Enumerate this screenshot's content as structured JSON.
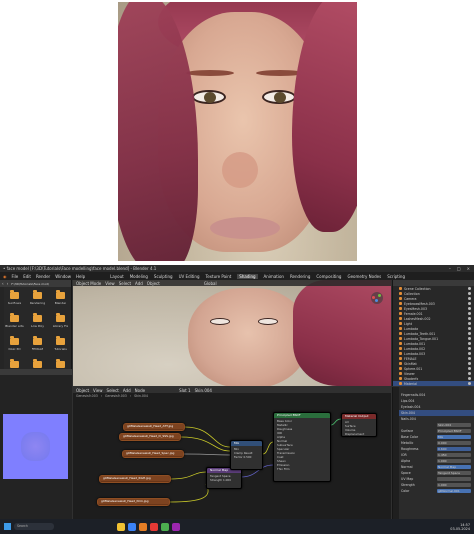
{
  "window": {
    "title": "• face model [F:\\3D\\Tutorials\\Face modelling\\face model.blend] - Blender 4.1"
  },
  "menu": {
    "items": [
      "File",
      "Edit",
      "Render",
      "Window",
      "Help"
    ],
    "workspaces": [
      "Layout",
      "Modeling",
      "Sculpting",
      "UV Editing",
      "Texture Paint",
      "Shading",
      "Animation",
      "Rendering",
      "Compositing",
      "Geometry Nodes",
      "Scripting"
    ],
    "active_workspace": "Shading"
  },
  "file_browser": {
    "path": "F:\\3D\\Tutorials\\Face mod\\",
    "folders": [
      "Sunflowe",
      "Rendering",
      "Blender",
      "Blender arts",
      "Low Poly",
      "Library Fix",
      "DALI 3D",
      "FEMALE",
      "Tutorials",
      "Bluestar",
      "Texture",
      "Ovally",
      "Obsidian",
      "Substance",
      "Fiddle"
    ]
  },
  "viewport": {
    "mode": "Object Mode",
    "shading": "Global"
  },
  "outliner": {
    "rows": [
      {
        "label": "Scene Collection",
        "selected": false
      },
      {
        "label": "Collection",
        "selected": false
      },
      {
        "label": "Camera",
        "selected": false
      },
      {
        "label": "EyebrowsMesh.003",
        "selected": false
      },
      {
        "label": "EyesMesh.003",
        "selected": false
      },
      {
        "label": "Female.001",
        "selected": false
      },
      {
        "label": "LashesMesh.002",
        "selected": false
      },
      {
        "label": "Light",
        "selected": false
      },
      {
        "label": "Lumbata",
        "selected": false
      },
      {
        "label": "Lumbata_Teeth.001",
        "selected": false
      },
      {
        "label": "Lumbata_Tongue.001",
        "selected": false
      },
      {
        "label": "Lumbata.001",
        "selected": false
      },
      {
        "label": "Lumbata.002",
        "selected": false
      },
      {
        "label": "Lumbata.003",
        "selected": false
      },
      {
        "label": "FEMALE",
        "selected": false
      },
      {
        "label": "SkinMat",
        "selected": false
      },
      {
        "label": "Sphere.001",
        "selected": false
      },
      {
        "label": "Viewer",
        "selected": false
      },
      {
        "label": "Shaderfx",
        "selected": false
      },
      {
        "label": "Material",
        "selected": true
      }
    ]
  },
  "properties": {
    "material_list": [
      "Fingernails.004",
      "Lips.004",
      "Eyelash.004",
      "Skin.004",
      "Nails.004"
    ],
    "active_material": "Skin.004",
    "rows": [
      {
        "label": "Surface",
        "value": "Principled BSDF",
        "style": ""
      },
      {
        "label": "Base Color",
        "value": "Mix",
        "style": "blue"
      },
      {
        "label": "Metallic",
        "value": "0.000",
        "style": ""
      },
      {
        "label": "Roughness",
        "value": "0.600",
        "style": "sel"
      },
      {
        "label": "IOR",
        "value": "1.450",
        "style": ""
      },
      {
        "label": "Alpha",
        "value": "1.000",
        "style": ""
      },
      {
        "label": "Normal",
        "value": "Normal Map",
        "style": "blue"
      },
      {
        "label": "Space",
        "value": "Tangent Space",
        "style": ""
      },
      {
        "label": "UV Map",
        "value": "",
        "style": ""
      },
      {
        "label": "Strength",
        "value": "1.000",
        "style": ""
      },
      {
        "label": "Color",
        "value": "gDNormal.001",
        "style": "blue"
      }
    ]
  },
  "node_editor": {
    "object": "Object",
    "breadcrumb": [
      "Genesis9.003",
      "Genesis9.003",
      "Skin.004"
    ],
    "slot": "Slot 1",
    "material": "Skin.004",
    "nodes": {
      "tex1": "g9MaleGenesis9_Head_ATT.jpg",
      "tex2": "g9MaleGenesis9_Head_D_SSS.jpg",
      "tex3": "g9MaleGenesis9_Head_Spec.jpg",
      "tex4": "g9MaleGenesis9_Head_RGH.jpg",
      "tex5": "g9MaleGenesis9_Head_Nrm.jpg",
      "normal_map": "Normal Map",
      "mix": "Mix",
      "bsdf": "Principled BSDF",
      "output": "Material Output"
    }
  },
  "taskbar": {
    "search": "Search",
    "time": "14:57",
    "date": "03-05-2024"
  }
}
